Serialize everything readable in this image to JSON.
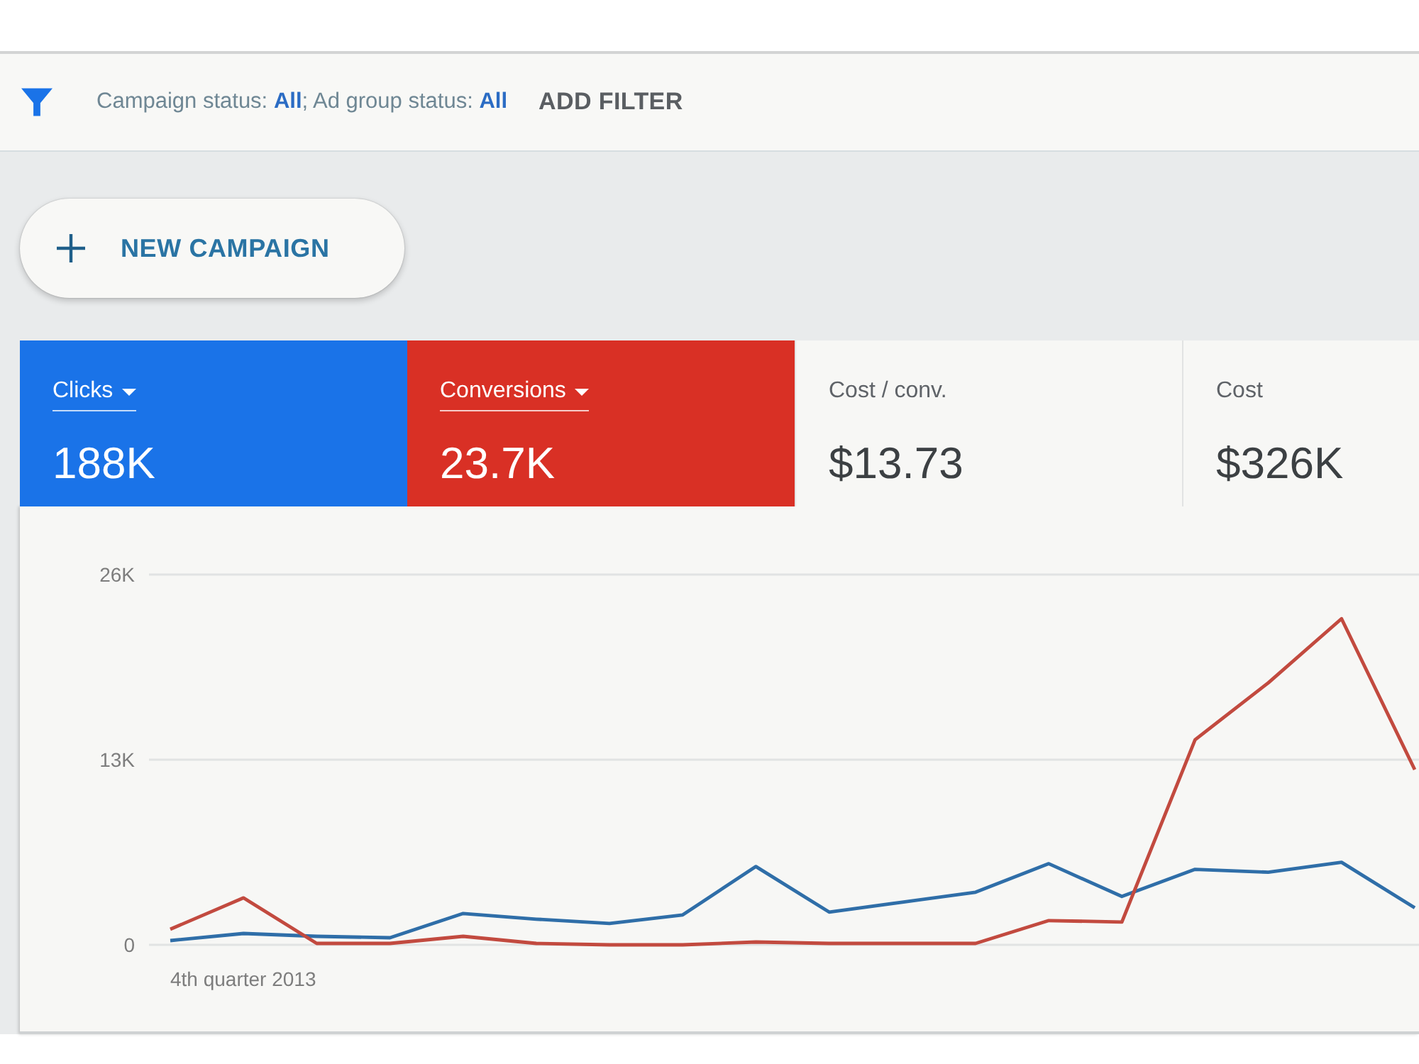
{
  "filter_bar": {
    "status_text": "Campaign status: **All**; Ad group status: **All**",
    "add_filter_button": "ADD FILTER"
  },
  "new_campaign_button": {
    "label": "NEW CAMPAIGN"
  },
  "metrics": [
    {
      "label": "Clicks",
      "value": "188K",
      "selected": true,
      "color": "#1a73e8"
    },
    {
      "label": "Conversions",
      "value": "23.7K",
      "selected": true,
      "color": "#d93025"
    },
    {
      "label": "Cost / conv.",
      "value": "$13.73",
      "selected": false
    },
    {
      "label": "Cost",
      "value": "$326K",
      "selected": false
    }
  ],
  "chart": {
    "start_label": "4th quarter 2013",
    "chart_data": {
      "type": "line",
      "ylim": [
        0,
        26000
      ],
      "yticks": [
        {
          "value": 0,
          "label": "0"
        },
        {
          "value": 13000,
          "label": "13K"
        },
        {
          "value": 26000,
          "label": "26K"
        }
      ],
      "series": [
        {
          "color": "#2f6ea8",
          "values": [
            300,
            800,
            600,
            500,
            2200,
            1800,
            1500,
            2100,
            5500,
            2300,
            3000,
            3700,
            5700,
            3400,
            5300,
            5100,
            5800,
            2600
          ]
        },
        {
          "color": "#c24a3f",
          "values": [
            1100,
            3300,
            100,
            100,
            600,
            100,
            0,
            0,
            200,
            100,
            100,
            100,
            1700,
            1600,
            14400,
            18400,
            22900,
            12300
          ]
        }
      ]
    }
  }
}
